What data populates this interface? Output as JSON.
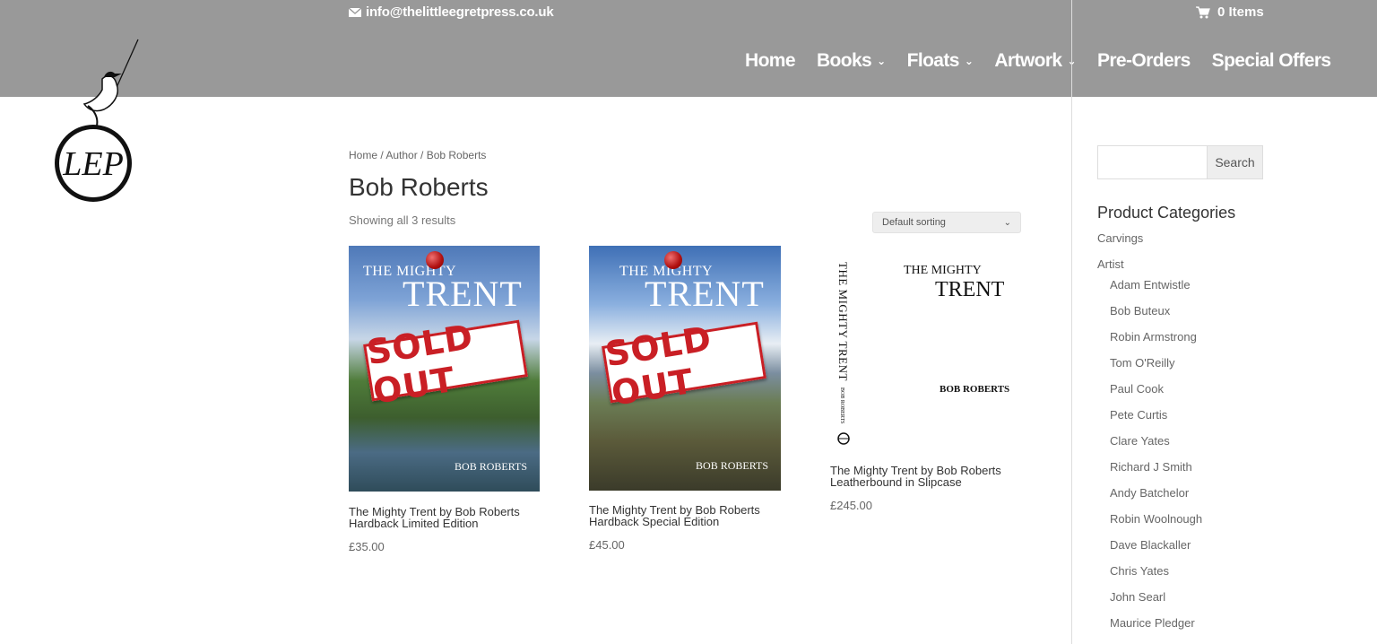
{
  "topbar": {
    "email": "info@thelittleegretpress.co.uk",
    "cart": "0 Items"
  },
  "nav": [
    {
      "label": "Home",
      "dropdown": false
    },
    {
      "label": "Books",
      "dropdown": true
    },
    {
      "label": "Floats",
      "dropdown": true
    },
    {
      "label": "Artwork",
      "dropdown": true
    },
    {
      "label": "Pre-Orders",
      "dropdown": false
    },
    {
      "label": "Special Offers",
      "dropdown": false
    }
  ],
  "logo_text": "LEP",
  "breadcrumb": "Home / Author / Bob Roberts",
  "page_title": "Bob Roberts",
  "result_count": "Showing all 3 results",
  "sorting": {
    "selected": "Default sorting"
  },
  "products": [
    {
      "title_line1": "The Mighty Trent by Bob Roberts",
      "title_line2": "Hardback Limited Edition",
      "price": "£35.00",
      "cover": {
        "top": "THE MIGHTY",
        "big": "TRENT",
        "author": "BOB ROBERTS",
        "badge": "SOLD OUT"
      }
    },
    {
      "title_line1": "The Mighty Trent by Bob Roberts",
      "title_line2": "Hardback Special Edition",
      "price": "£45.00",
      "cover": {
        "top": "THE MIGHTY",
        "big": "TRENT",
        "author": "BOB ROBERTS",
        "badge": "SOLD OUT"
      }
    },
    {
      "title_line1": "The Mighty Trent by Bob Roberts",
      "title_line2": "Leatherbound in Slipcase",
      "price": "£245.00",
      "cover": {
        "spine": "THE MIGHTY TRENT",
        "spine_author": "BOB ROBERTS",
        "top": "THE MIGHTY",
        "big": "TRENT",
        "author": "BOB ROBERTS"
      }
    }
  ],
  "sidebar": {
    "search_button": "Search",
    "search_value": "",
    "categories_title": "Product Categories",
    "categories": [
      "Carvings",
      "Artist"
    ],
    "artists": [
      "Adam Entwistle",
      "Bob Buteux",
      "Robin Armstrong",
      "Tom O'Reilly",
      "Paul Cook",
      "Pete Curtis",
      "Clare Yates",
      "Richard J Smith",
      "Andy Batchelor",
      "Robin Woolnough",
      "Dave Blackaller",
      "Chris Yates",
      "John Searl",
      "Maurice Pledger"
    ]
  }
}
